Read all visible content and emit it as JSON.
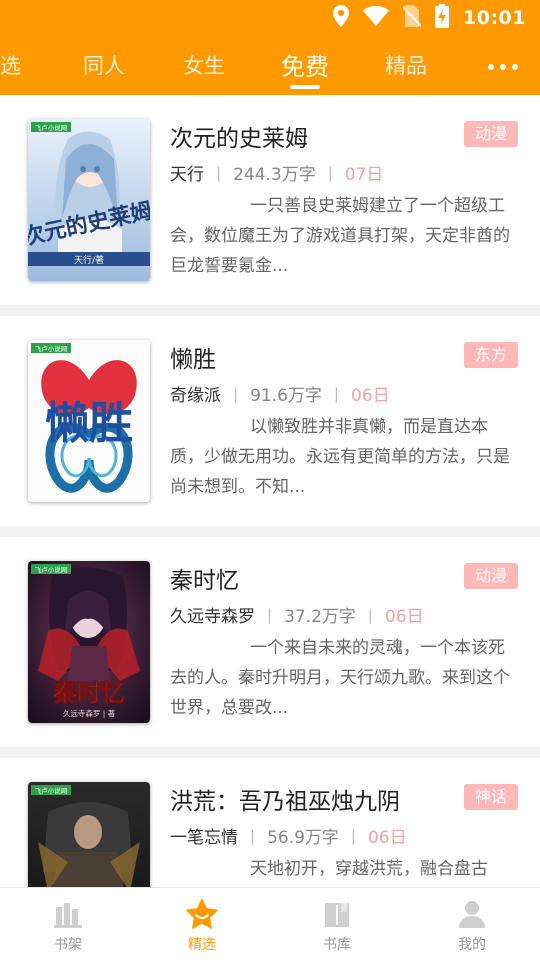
{
  "status_bar": {
    "time": "10:01"
  },
  "top_tabs": {
    "items": [
      {
        "label": "选"
      },
      {
        "label": "同人"
      },
      {
        "label": "女生"
      },
      {
        "label": "免费"
      },
      {
        "label": "精品"
      }
    ],
    "active": "免费",
    "more_icon": "more-dots-icon"
  },
  "books": [
    {
      "title": "次元的史莱姆",
      "tag": "动漫",
      "author": "天行",
      "words": "244.3万字",
      "date": "07日",
      "desc": "一只善良史莱姆建立了一个超级工会，数位魔王为了游戏道具打架，天定非酋的巨龙誓要氪金...",
      "cover_title": "次元的史莱姆",
      "cover_author": "天行/著",
      "cover_badge": "飞卢小说网"
    },
    {
      "title": "懒胜",
      "tag": "东方",
      "author": "奇缘派",
      "words": "91.6万字",
      "date": "06日",
      "desc": "以懒致胜并非真懒，而是直达本质，少做无用功。永远有更简单的方法，只是尚未想到。不知...",
      "cover_title": "懒胜",
      "cover_badge": "飞卢小说网"
    },
    {
      "title": "秦时忆",
      "tag": "动漫",
      "author": "久远寺森罗",
      "words": "37.2万字",
      "date": "06日",
      "desc": "一个来自未来的灵魂，一个本该死去的人。秦时升明月，天行颂九歌。来到这个世界，总要改...",
      "cover_title": "秦时忆",
      "cover_author": "久远寺森罗 | 著",
      "cover_badge": "飞卢小说网"
    },
    {
      "title": "洪荒：吾乃祖巫烛九阴",
      "tag": "神话",
      "author": "一笔忘情",
      "words": "56.9万字",
      "date": "06日",
      "desc": "天地初开，穿越洪荒，融合盘古",
      "cover_badge": "飞卢小说网"
    }
  ],
  "bottom_nav": {
    "items": [
      {
        "label": "书架",
        "icon": "bookshelf-icon"
      },
      {
        "label": "精选",
        "icon": "featured-star-icon"
      },
      {
        "label": "书库",
        "icon": "library-book-icon"
      },
      {
        "label": "我的",
        "icon": "profile-icon"
      }
    ],
    "active": "精选"
  },
  "colors": {
    "accent": "#FF9900",
    "tag_bg": "#FFB8B8",
    "date_text": "#F2A2A2",
    "nav_inactive": "#999999"
  }
}
